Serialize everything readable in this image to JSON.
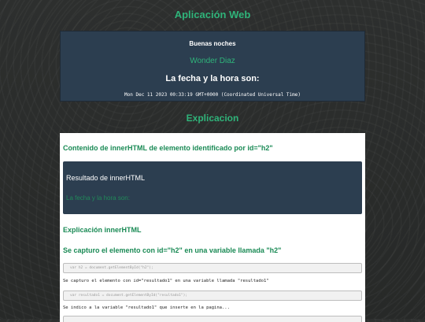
{
  "app": {
    "title": "Aplicación Web"
  },
  "greeting_card": {
    "greeting": "Buenas noches",
    "user_name": "Wonder Diaz",
    "date_label": "La fecha y la hora son:",
    "date_value": "Mon Dec 11 2023 00:33:19 GMT+0000 (Coordinated Universal Time)"
  },
  "explanation": {
    "section_title": "Explicacion",
    "inner_title": "Contenido de innerHTML de elemento identificado por id=\"h2\"",
    "result_title": "Resultado de innerHTML",
    "result_text": "La fecha y la hora son:",
    "expl_heading": "Explicación innerHTML",
    "capture_heading": "Se capturo el elemento con id=\"h2\" en una variable llamada \"h2\"",
    "code_1": "var h2 = document.getElementById(\"h2\");",
    "text_1": "Se capturo el elemento con id=\"resultado1\" en una variable llamada \"resultado1\"",
    "code_2": "var resultado1 = document.getElementById(\"resultado1\");",
    "text_2": "Se indico a la variable \"resultado1\" que inserte en la pagina...",
    "code_3": ""
  },
  "colors": {
    "accent_green": "#2fb47a",
    "card_bg": "#2c3e50",
    "page_bg": "#2b2d2c"
  }
}
